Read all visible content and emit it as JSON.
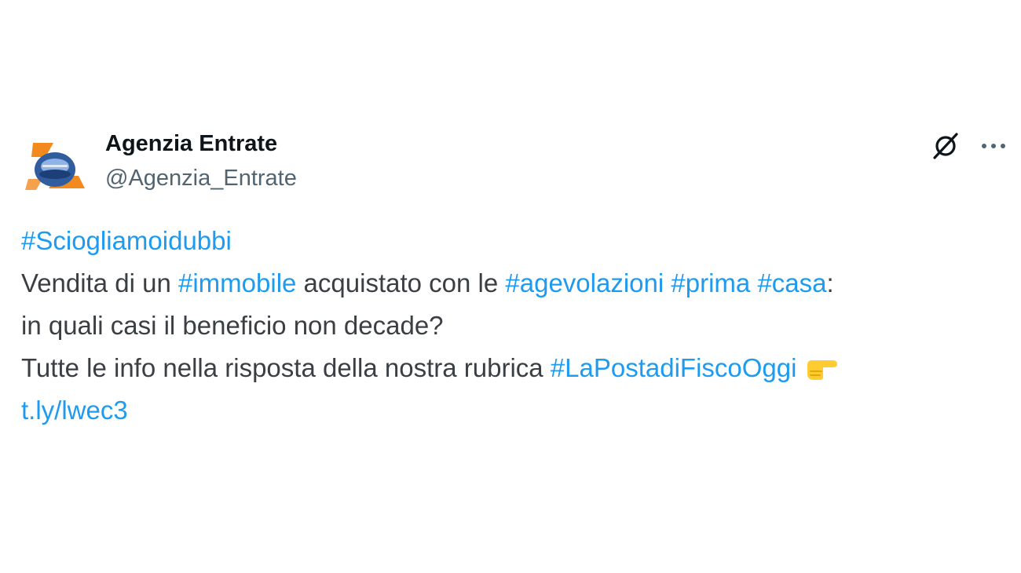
{
  "tweet": {
    "author": {
      "name": "Agenzia Entrate",
      "handle": "@Agenzia_Entrate",
      "avatar_icon": "agenzia-entrate-logo"
    },
    "actions": {
      "grok_icon": "grok-icon",
      "more_icon": "more-options-icon",
      "more_label": "···"
    },
    "body": {
      "line1": {
        "hashtag": "#Sciogliamoidubbi"
      },
      "line2": {
        "t1": "Vendita di un ",
        "h1": "#immobile",
        "t2": " acquistato con le ",
        "h2": "#agevolazioni",
        "t3": " ",
        "h3": "#prima",
        "t4": " ",
        "h4": "#casa",
        "t5": ":"
      },
      "line3": {
        "text": "in quali casi il beneficio non decade?"
      },
      "line4": {
        "text": "Tutte le info nella risposta della nostra rubrica ",
        "hashtag": "#LaPostadiFiscoOggi",
        "emoji": "backhand-index-pointing-right"
      },
      "line5": {
        "link": "t.ly/lwec3"
      }
    },
    "colors": {
      "link": "#1d9bf0",
      "text": "#3b3f44",
      "handle": "#536471",
      "logo_orange": "#f28a1e",
      "logo_blue": "#2f5d9e"
    }
  }
}
